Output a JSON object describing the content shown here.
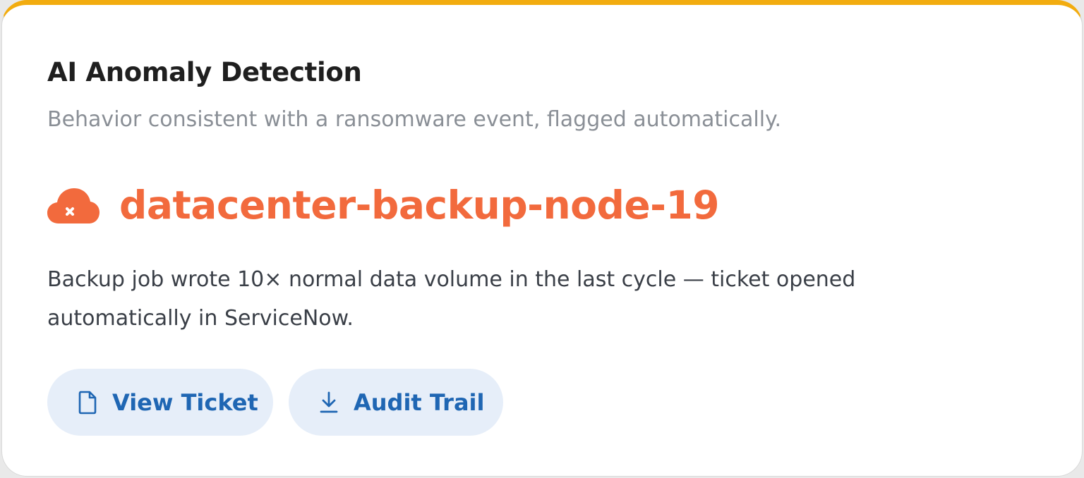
{
  "card": {
    "title": "AI Anomaly Detection",
    "subtitle": "Behavior consistent with a ransomware event, flagged automatically.",
    "accent_color": "#f2ac0f"
  },
  "alert": {
    "node_name": "datacenter-backup-node-19",
    "node_icon": "cloud-error-icon",
    "color": "#f26a3d",
    "description": "Backup job wrote 10× normal data volume in the last cycle — ticket opened automatically in ServiceNow."
  },
  "actions": [
    {
      "label": "View Ticket",
      "icon": "document-icon"
    },
    {
      "label": "Audit Trail",
      "icon": "download-icon"
    }
  ],
  "button_color": "#1f66b3"
}
